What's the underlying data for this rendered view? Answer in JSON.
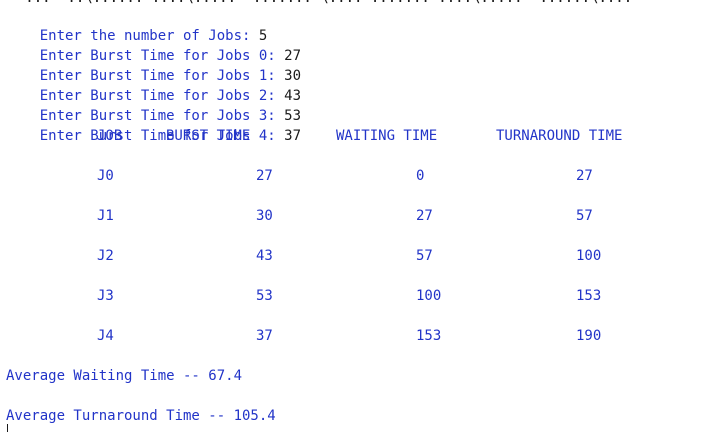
{
  "console": {
    "cut_header": "   ...  ..\\...... ....\\.....  ....... \\.... ....... ....\\.....  ......\\....",
    "prompts": [
      {
        "label": "Enter the number of Jobs: ",
        "value": "5"
      },
      {
        "label": "Enter Burst Time for Jobs 0: ",
        "value": "27"
      },
      {
        "label": "Enter Burst Time for Jobs 1: ",
        "value": "30"
      },
      {
        "label": "Enter Burst Time for Jobs 2: ",
        "value": "43"
      },
      {
        "label": "Enter Burst Time for Jobs 3: ",
        "value": "53"
      },
      {
        "label": "Enter Burst Time for Jobs 4: ",
        "value": "37"
      }
    ],
    "table": {
      "headers": [
        "JOB",
        "BURST TIME",
        "WAITING TIME",
        "TURNAROUND TIME"
      ],
      "rows": [
        [
          "J0",
          "27",
          "0",
          "27"
        ],
        [
          "J1",
          "30",
          "27",
          "57"
        ],
        [
          "J2",
          "43",
          "57",
          "100"
        ],
        [
          "J3",
          "53",
          "100",
          "153"
        ],
        [
          "J4",
          "37",
          "153",
          "190"
        ]
      ]
    },
    "avg_waiting": "Average Waiting Time -- 67.4",
    "avg_turnaround": "Average Turnaround Time -- 105.4"
  }
}
